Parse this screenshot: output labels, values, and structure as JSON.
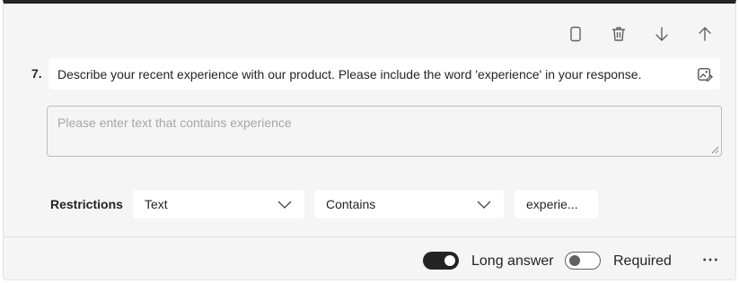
{
  "toolbar": {
    "icons": [
      "copy-icon",
      "delete-icon",
      "move-down-icon",
      "move-up-icon"
    ]
  },
  "question": {
    "number": "7.",
    "text": "Describe your recent experience with our product. Please include the word 'experience' in your response.",
    "image_icon": "insert-image-icon"
  },
  "answer": {
    "placeholder": "Please enter text that contains experience"
  },
  "restrictions": {
    "label": "Restrictions",
    "type_value": "Text",
    "condition_value": "Contains",
    "keyword_value": "experie..."
  },
  "footer": {
    "long_answer_label": "Long answer",
    "long_answer_on": true,
    "required_label": "Required",
    "required_on": false,
    "more_icon": "more-options-icon"
  },
  "colors": {
    "card_background": "#f5f5f5",
    "accent_dark": "#242424",
    "placeholder_text": "#a6a6a6"
  }
}
